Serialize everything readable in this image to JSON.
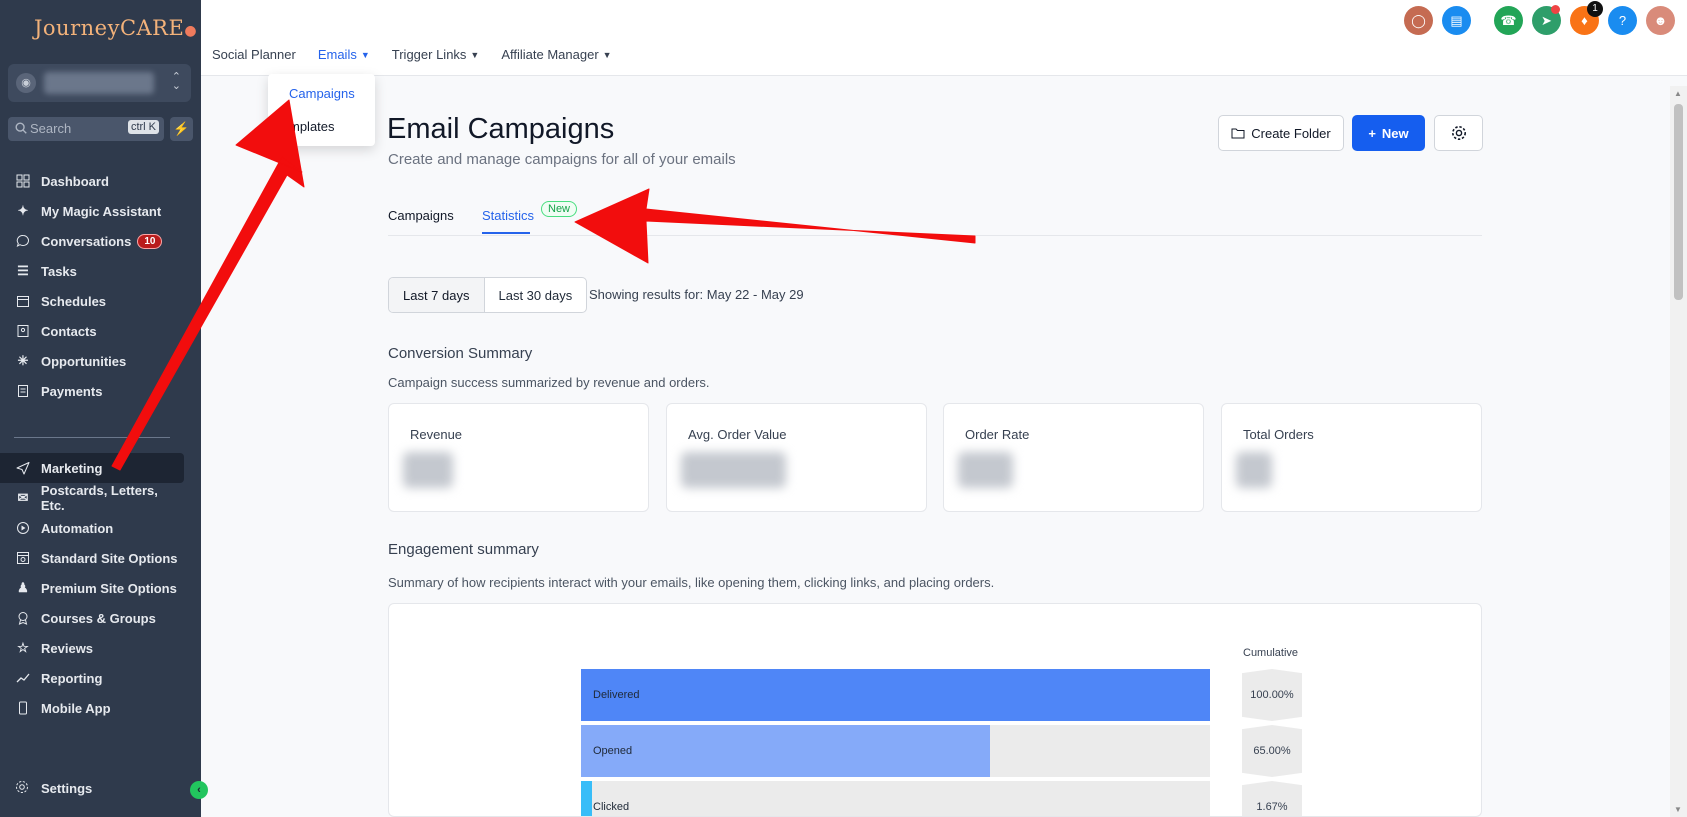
{
  "brand": {
    "logo_text": "JourneyCARE"
  },
  "sidebar": {
    "search_placeholder": "Search",
    "search_shortcut": "ctrl K",
    "items": [
      {
        "label": "Dashboard",
        "icon": "dashboard-icon"
      },
      {
        "label": "My Magic Assistant",
        "icon": "magic-wand-icon"
      },
      {
        "label": "Conversations",
        "icon": "chat-bubble-icon",
        "badge": "10"
      },
      {
        "label": "Tasks",
        "icon": "checklist-icon"
      },
      {
        "label": "Schedules",
        "icon": "calendar-icon"
      },
      {
        "label": "Contacts",
        "icon": "contacts-book-icon"
      },
      {
        "label": "Opportunities",
        "icon": "network-icon"
      },
      {
        "label": "Payments",
        "icon": "receipt-icon"
      },
      {
        "label": "Marketing",
        "icon": "send-icon",
        "active": true
      },
      {
        "label": "Postcards, Letters, Etc.",
        "icon": "mail-stack-icon"
      },
      {
        "label": "Automation",
        "icon": "automation-icon"
      },
      {
        "label": "Standard Site Options",
        "icon": "site-icon"
      },
      {
        "label": "Premium Site Options",
        "icon": "premium-icon"
      },
      {
        "label": "Courses & Groups",
        "icon": "award-icon"
      },
      {
        "label": "Reviews",
        "icon": "star-icon"
      },
      {
        "label": "Reporting",
        "icon": "trend-icon"
      },
      {
        "label": "Mobile App",
        "icon": "mobile-icon"
      }
    ],
    "settings_label": "Settings"
  },
  "topnav": {
    "items": [
      {
        "label": "Social Planner",
        "caret": false
      },
      {
        "label": "Emails",
        "caret": true,
        "active": true
      },
      {
        "label": "Trigger Links",
        "caret": true
      },
      {
        "label": "Affiliate Manager",
        "caret": true
      }
    ],
    "notifications_count": "1"
  },
  "dropdown": {
    "items": [
      "Campaigns",
      "mplates"
    ]
  },
  "page": {
    "title": "Email Campaigns",
    "subtitle": "Create and manage campaigns for all of your emails",
    "create_folder_label": "Create Folder",
    "new_label": "New",
    "tabs": [
      "Campaigns",
      "Statistics"
    ],
    "new_pill": "New",
    "range_options": [
      "Last 7 days",
      "Last 30 days"
    ],
    "showing": "Showing results for: May 22 - May 29",
    "conversion": {
      "title": "Conversion Summary",
      "desc": "Campaign success summarized by revenue and orders.",
      "cards": [
        "Revenue",
        "Avg. Order Value",
        "Order Rate",
        "Total Orders"
      ]
    },
    "engagement": {
      "title": "Engagement summary",
      "desc": "Summary of how recipients interact with your emails, like opening them, clicking links, and placing orders.",
      "cumulative_label": "Cumulative"
    }
  },
  "chart_data": {
    "type": "bar",
    "categories": [
      "Delivered",
      "Opened",
      "Clicked"
    ],
    "values": [
      100.0,
      65.0,
      1.67
    ],
    "cumulative": [
      "100.00%",
      "65.00%",
      "1.67%"
    ],
    "colors": [
      "#4f86f7",
      "#85aaf9",
      "#38bdf8"
    ]
  },
  "colors": {
    "accent": "#155eef",
    "sidebar_bg": "#2f3a4c",
    "annotation": "#f20d0d"
  }
}
